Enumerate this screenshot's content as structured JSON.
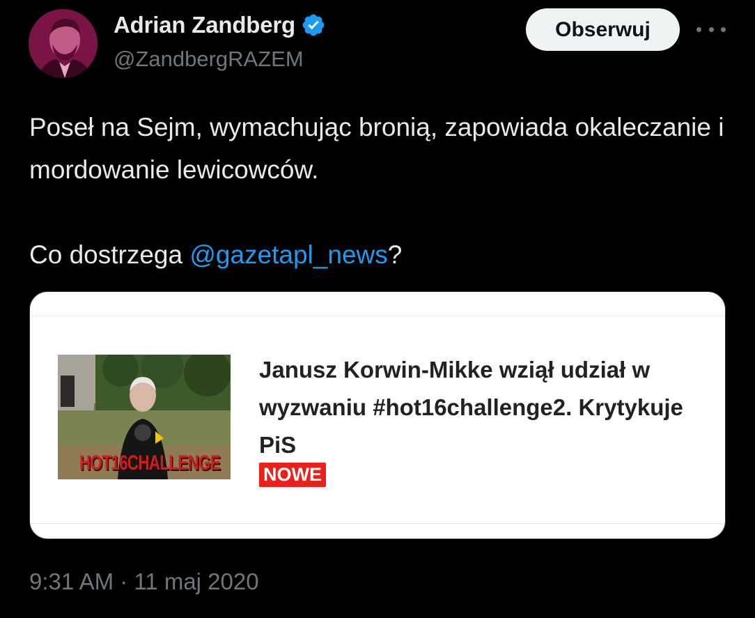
{
  "author": {
    "name": "Adrian Zandberg",
    "handle": "@ZandbergRAZEM",
    "verified_color": "#1d9bf0",
    "avatar_bg": "#7a1446"
  },
  "actions": {
    "follow_label": "Obserwuj",
    "more_icon": "more-horizontal-icon"
  },
  "tweet": {
    "line1": "Poseł na Sejm, wymachując bronią, zapowiada okaleczanie i mordowanie lewicowców.",
    "line2_prefix": "Co dostrzega ",
    "mention": "@gazetapl_news",
    "line2_suffix": "?",
    "mention_color": "#1d9bf0"
  },
  "card": {
    "title": "Janusz Korwin-Mikke wziął udział w wyzwaniu #hot16challenge2. Krytykuje PiS",
    "badge": "NOWE",
    "badge_color": "#e8211a",
    "thumbnail_label": "HOT16CHALLENGE"
  },
  "meta": {
    "timestamp": "9:31 AM · 11 maj 2020"
  }
}
